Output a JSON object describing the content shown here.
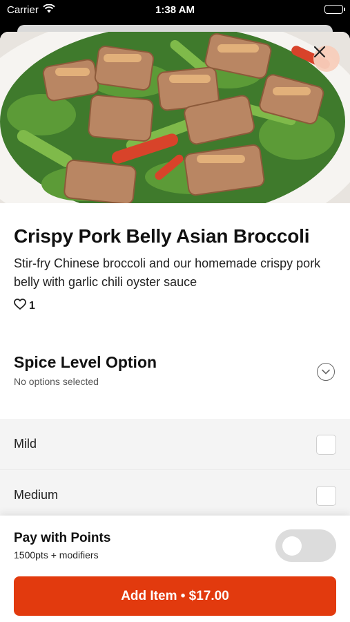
{
  "status_bar": {
    "carrier": "Carrier",
    "time": "1:38 AM"
  },
  "item": {
    "title": "Crispy Pork Belly Asian Broccoli",
    "description": "Stir-fry Chinese broccoli and our homemade crispy pork belly with garlic chili oyster sauce",
    "likes": "1"
  },
  "option": {
    "title": "Spice Level Option",
    "subtitle": "No options selected",
    "choices": [
      {
        "label": "Mild",
        "checked": false
      },
      {
        "label": "Medium",
        "checked": false
      }
    ]
  },
  "points": {
    "label": "Pay with Points",
    "subtitle": "1500pts + modifiers",
    "enabled": false
  },
  "cta": {
    "label": "Add Item • $17.00"
  },
  "colors": {
    "accent": "#e23a0e",
    "close_button_bg": "#f8cdba",
    "toggle_off": "#dcdcdc"
  },
  "icons": [
    "wifi-icon",
    "battery-icon",
    "close-icon",
    "heart-icon",
    "chevron-down-icon"
  ]
}
